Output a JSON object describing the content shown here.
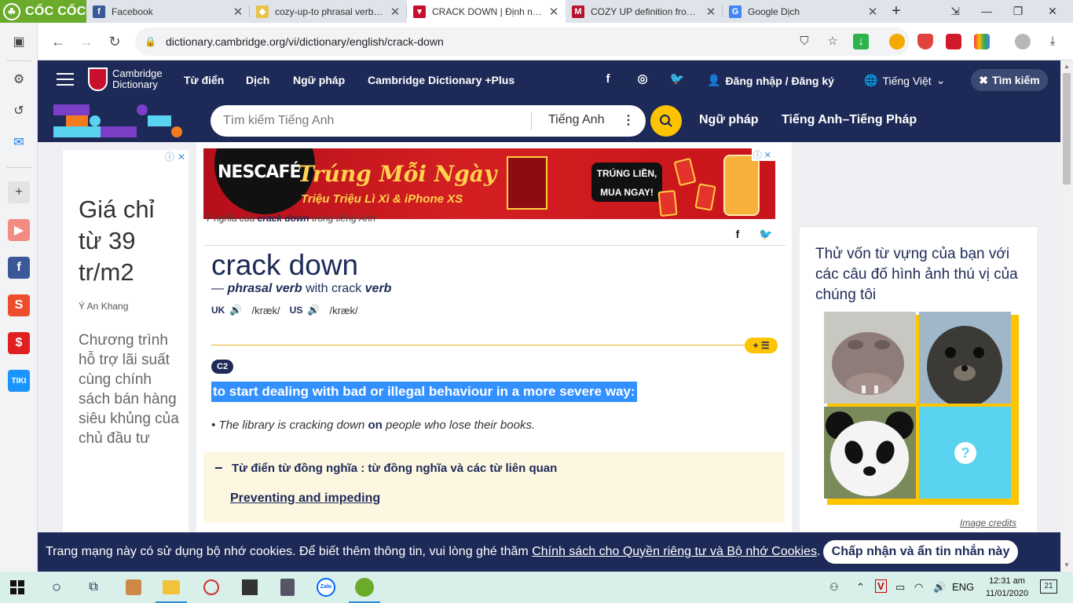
{
  "browser": {
    "brand": "CỐC CỐC",
    "tabs": [
      {
        "title": "Facebook",
        "active": false
      },
      {
        "title": "cozy-up-to phrasal verb - D",
        "active": false
      },
      {
        "title": "CRACK DOWN | Định nghĩa",
        "active": true
      },
      {
        "title": "COZY UP definition from M",
        "active": false
      },
      {
        "title": "Google Dịch",
        "active": false
      }
    ],
    "url": "dictionary.cambridge.org/vi/dictionary/english/crack-down"
  },
  "site": {
    "logo_line1": "Cambridge",
    "logo_line2": "Dictionary",
    "nav": [
      "Từ điển",
      "Dịch",
      "Ngữ pháp",
      "Cambridge Dictionary +Plus"
    ],
    "login": "Đăng nhập / Đăng ký",
    "language": "Tiếng Việt",
    "search_button": "Tìm kiếm",
    "search_placeholder": "Tìm kiếm Tiếng Anh",
    "search_dict": "Tiếng Anh",
    "quick_links": [
      "Ngữ pháp",
      "Tiếng Anh–Tiếng Pháp"
    ]
  },
  "left_ad": {
    "headline": "Giá chỉ từ 39 tr/m2",
    "brand": "Ý An Khang",
    "body": "Chương trình hỗ trợ lãi suất cùng chính sách bán hàng siêu khủng của chủ đầu tư"
  },
  "banner": {
    "brand": "NESCAFÉ",
    "headline": "Trúng Mỗi Ngày",
    "sub": "Triệu Triệu Lì Xì & iPhone XS",
    "cta_line1": "TRÚNG LIỀN,",
    "cta_line2": "MUA NGAY!"
  },
  "entry": {
    "crumb_prefix": "Ý nghĩa của",
    "crumb_word": "crack down",
    "crumb_suffix": "trong tiếng Anh",
    "headword": "crack down",
    "pos_dash": "—",
    "pos": "phrasal verb",
    "with": "with crack",
    "with_pos": "verb",
    "uk_label": "UK",
    "uk_ipa": "/kræk/",
    "us_label": "US",
    "us_ipa": "/kræk/",
    "add_list": "+ ☰",
    "level": "C2",
    "definition": "to start dealing with bad or illegal behaviour in a more severe way:",
    "example_before": "The library is cracking down",
    "example_bold": "on",
    "example_after": "people who lose their books.",
    "thesaurus_title": "Từ điển từ đồng nghĩa : từ đồng nghĩa và các từ liên quan",
    "thesaurus_link": "Preventing and impeding"
  },
  "quiz": {
    "title": "Thử vốn từ vựng của bạn với các câu đố hình ảnh thú vị của chúng tôi",
    "image_credits": "Image credits"
  },
  "cookie": {
    "message": "Trang mạng này có sử dụng bộ nhớ cookies. Để biết thêm thông tin, vui lòng ghé thăm",
    "link": "Chính sách cho Quyền riêng tư và Bộ nhớ Cookies",
    "end": ".",
    "accept": "Chấp nhận và ẩn tin nhắn này"
  },
  "taskbar": {
    "lang": "ENG",
    "time": "12:31 am",
    "date": "11/01/2020",
    "notifications": "21"
  }
}
